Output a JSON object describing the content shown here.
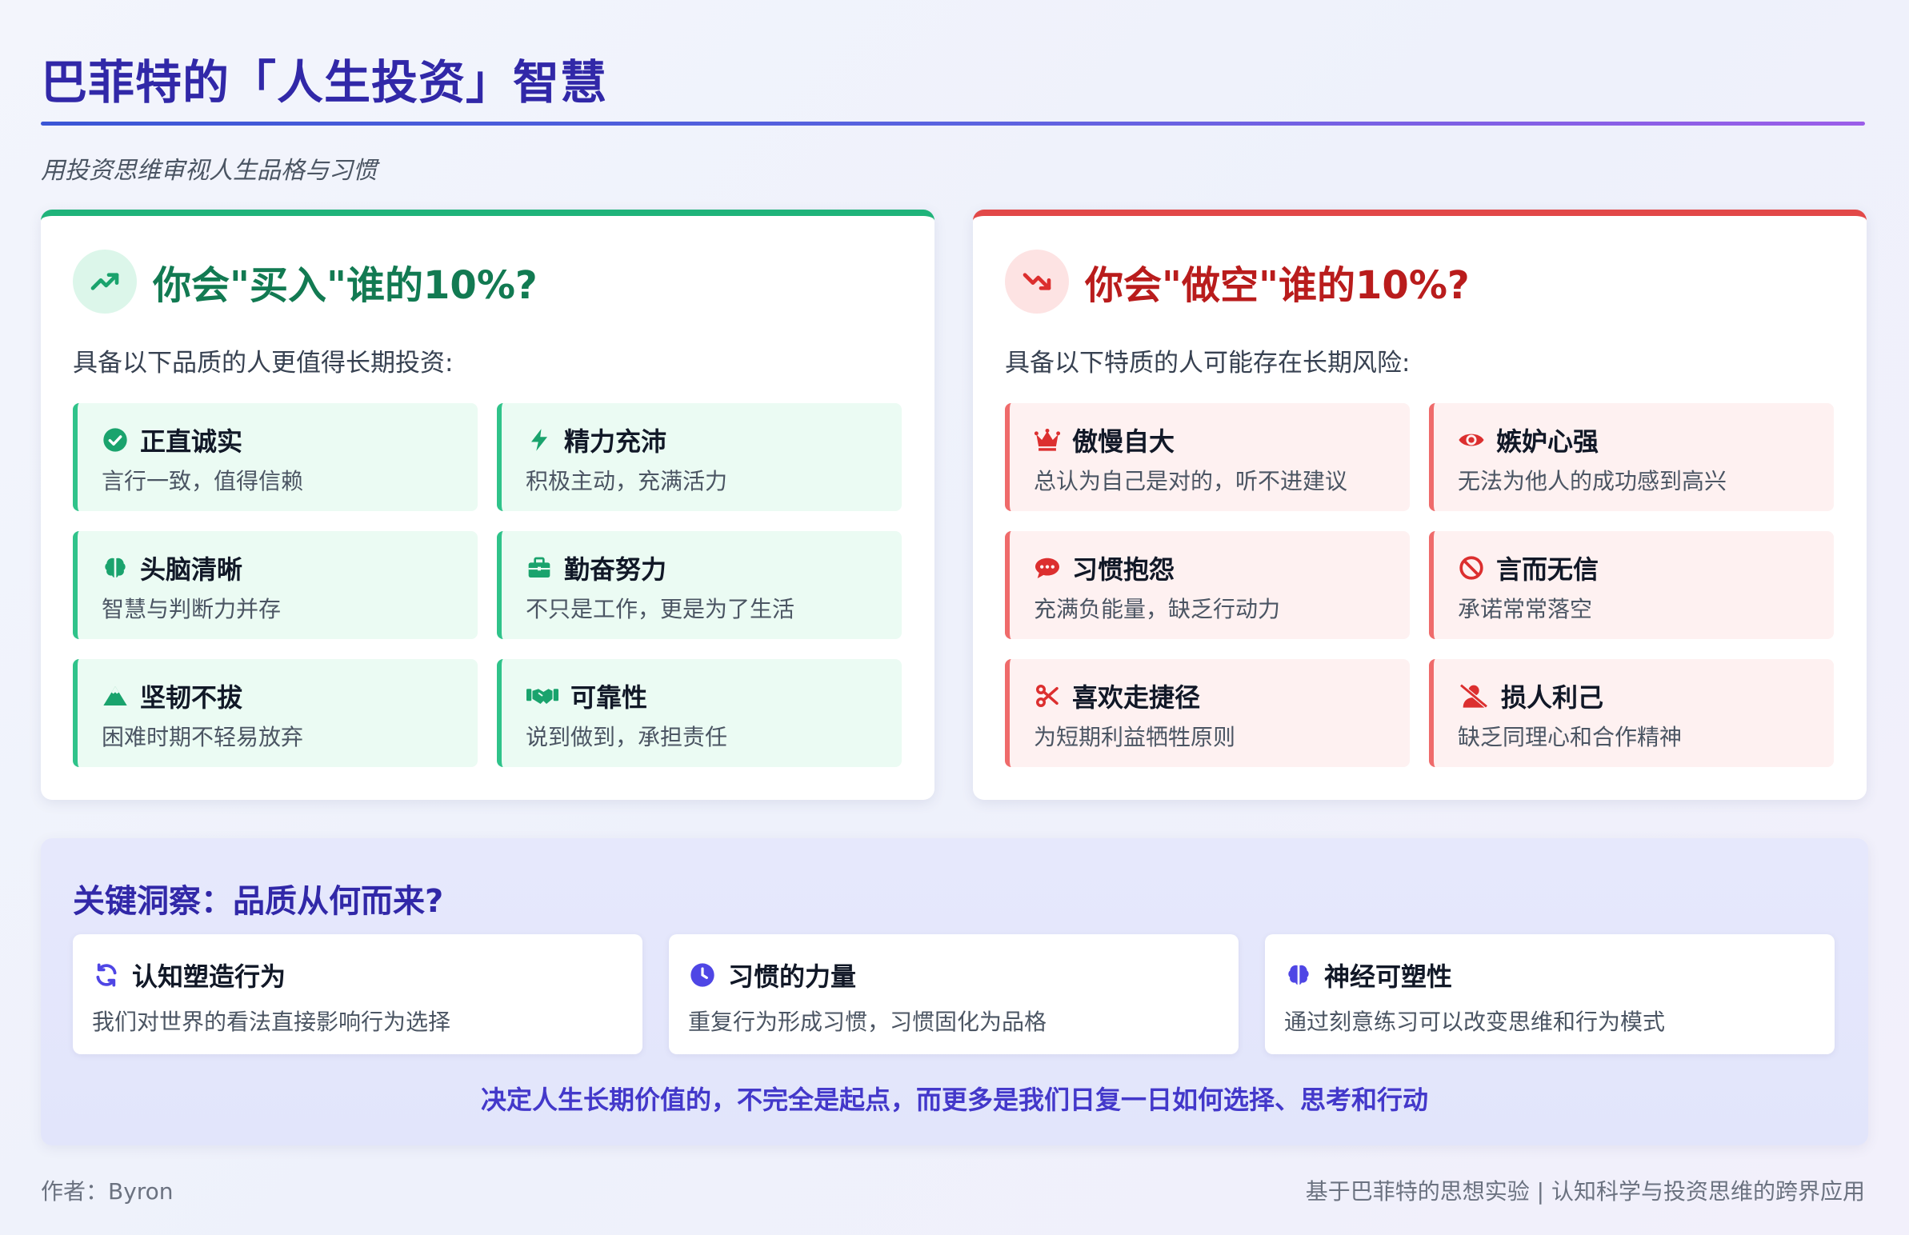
{
  "header": {
    "title": "巴菲特的「人生投资」智慧",
    "subtitle": "用投资思维审视人生品格与习惯"
  },
  "buy_panel": {
    "icon": "trending-up-icon",
    "title": "你会\"买入\"谁的10%?",
    "intro": "具备以下品质的人更值得长期投资:",
    "accent_color": "#1fb37a",
    "traits": [
      {
        "icon": "check-circle-icon",
        "name": "正直诚实",
        "desc": "言行一致，值得信赖"
      },
      {
        "icon": "bolt-icon",
        "name": "精力充沛",
        "desc": "积极主动，充满活力"
      },
      {
        "icon": "brain-icon",
        "name": "头脑清晰",
        "desc": "智慧与判断力并存"
      },
      {
        "icon": "briefcase-icon",
        "name": "勤奋努力",
        "desc": "不只是工作，更是为了生活"
      },
      {
        "icon": "mountain-icon",
        "name": "坚韧不拔",
        "desc": "困难时期不轻易放弃"
      },
      {
        "icon": "handshake-icon",
        "name": "可靠性",
        "desc": "说到做到，承担责任"
      }
    ]
  },
  "short_panel": {
    "icon": "trending-down-icon",
    "title": "你会\"做空\"谁的10%?",
    "intro": "具备以下特质的人可能存在长期风险:",
    "accent_color": "#e24848",
    "traits": [
      {
        "icon": "crown-icon",
        "name": "傲慢自大",
        "desc": "总认为自己是对的，听不进建议"
      },
      {
        "icon": "eye-icon",
        "name": "嫉妒心强",
        "desc": "无法为他人的成功感到高兴"
      },
      {
        "icon": "comment-dots-icon",
        "name": "习惯抱怨",
        "desc": "充满负能量，缺乏行动力"
      },
      {
        "icon": "ban-icon",
        "name": "言而无信",
        "desc": "承诺常常落空"
      },
      {
        "icon": "scissors-icon",
        "name": "喜欢走捷径",
        "desc": "为短期利益牺牲原则"
      },
      {
        "icon": "user-slash-icon",
        "name": "损人利己",
        "desc": "缺乏同理心和合作精神"
      }
    ]
  },
  "insight": {
    "title": "关键洞察：品质从何而来?",
    "cards": [
      {
        "icon": "sync-icon",
        "name": "认知塑造行为",
        "desc": "我们对世界的看法直接影响行为选择"
      },
      {
        "icon": "clock-icon",
        "name": "习惯的力量",
        "desc": "重复行为形成习惯，习惯固化为品格"
      },
      {
        "icon": "brain-icon",
        "name": "神经可塑性",
        "desc": "通过刻意练习可以改变思维和行为模式"
      }
    ],
    "conclusion": "决定人生长期价值的，不完全是起点，而更多是我们日复一日如何选择、思考和行动"
  },
  "footer": {
    "author": "作者：Byron",
    "source": "基于巴菲特的思想实验 | 认知科学与投资思维的跨界应用"
  }
}
